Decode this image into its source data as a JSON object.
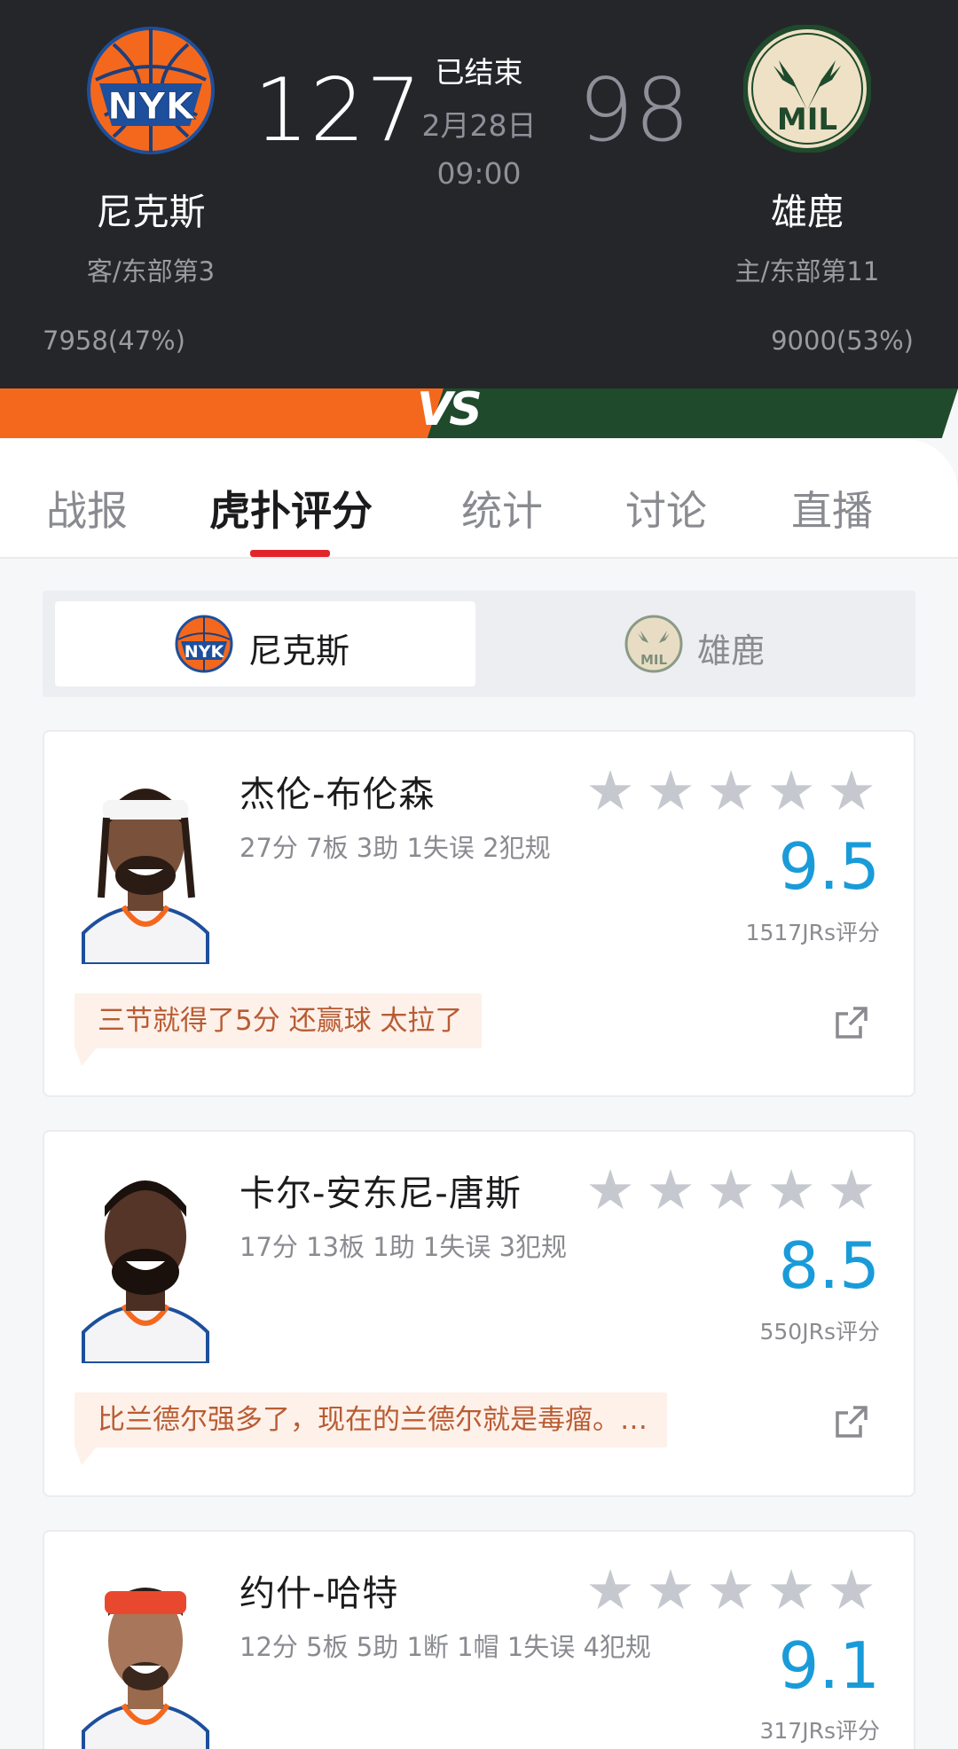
{
  "game": {
    "status": "已结束",
    "date": "2月28日",
    "time": "09:00",
    "vs": "VS",
    "away": {
      "name": "尼克斯",
      "logo_text": "NYK",
      "rank": "客/东部第3",
      "score": "127",
      "support": "7958(47%)",
      "color": "#f4681d"
    },
    "home": {
      "name": "雄鹿",
      "logo_text": "MIL",
      "rank": "主/东部第11",
      "score": "98",
      "support": "9000(53%)",
      "color": "#1f4a2c"
    }
  },
  "tabs": [
    {
      "label": "战报"
    },
    {
      "label": "虎扑评分"
    },
    {
      "label": "统计"
    },
    {
      "label": "讨论"
    },
    {
      "label": "直播"
    }
  ],
  "active_tab": "虎扑评分",
  "team_switch": {
    "left": {
      "label": "尼克斯",
      "selected": true
    },
    "right": {
      "label": "雄鹿",
      "selected": false
    }
  },
  "players": [
    {
      "name": "杰伦-布伦森",
      "stats": "27分 7板 3助 1失误 2犯规",
      "rating": "9.5",
      "votes": "1517JRs评分",
      "comment": "三节就得了5分 还赢球 太拉了",
      "headband": "#ffffff"
    },
    {
      "name": "卡尔-安东尼-唐斯",
      "stats": "17分 13板 1助 1失误 3犯规",
      "rating": "8.5",
      "votes": "550JRs评分",
      "comment": "比兰德尔强多了，现在的兰德尔就是毒瘤。…",
      "headband": "none"
    },
    {
      "name": "约什-哈特",
      "stats": "12分 5板 5助 1断 1帽 1失误 4犯规",
      "rating": "9.1",
      "votes": "317JRs评分",
      "comment": "",
      "headband": "#e8492e"
    }
  ],
  "colors": {
    "header_bg": "#25262a",
    "accent_red": "#e0262c",
    "rating_blue": "#1a9bd9",
    "comment_bg": "#fdf1ea",
    "comment_text": "#b95c33"
  }
}
